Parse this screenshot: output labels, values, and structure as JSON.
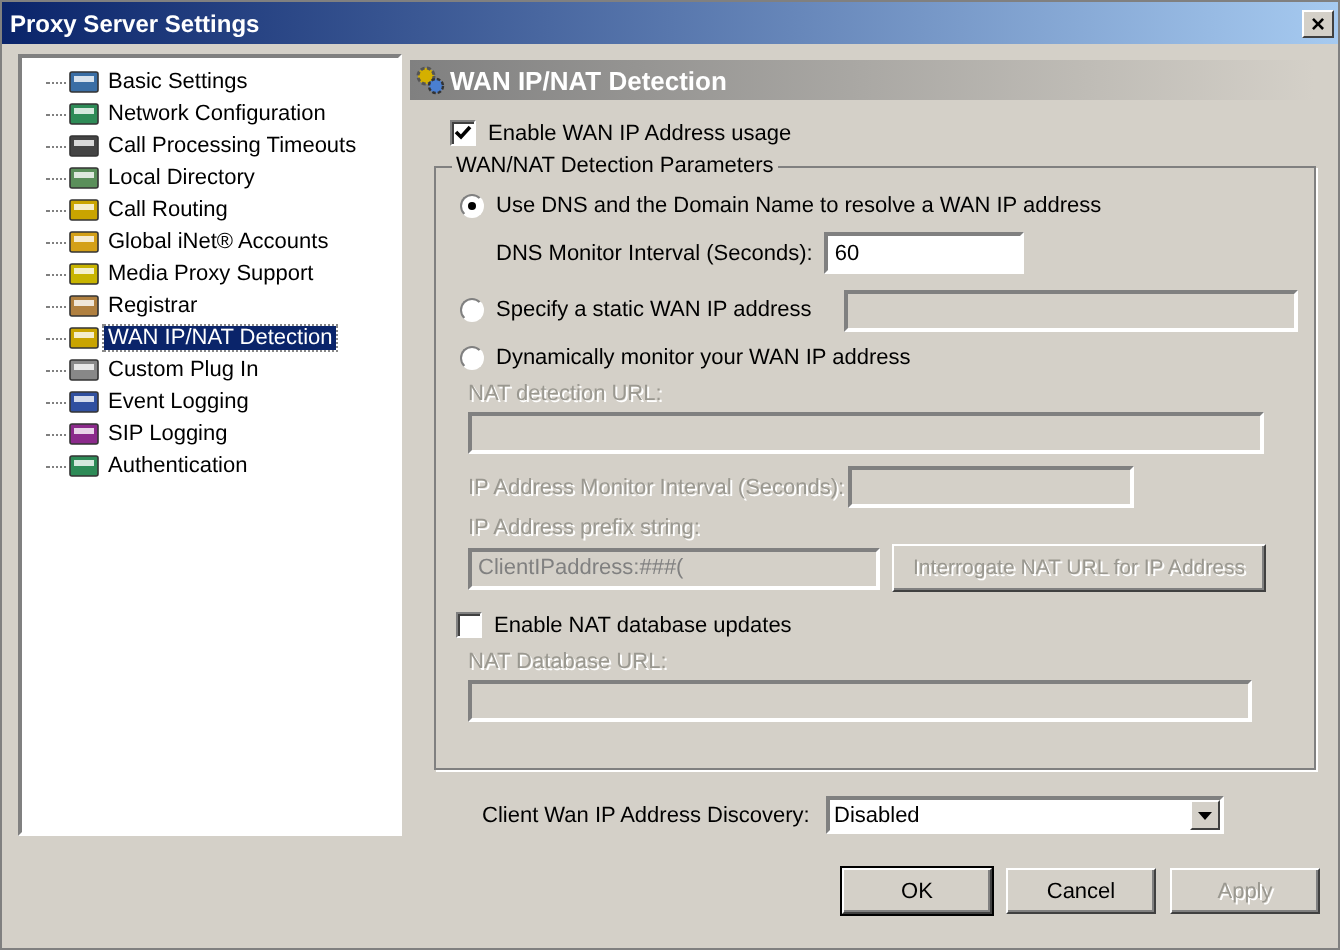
{
  "window": {
    "title": "Proxy Server Settings",
    "close": "×"
  },
  "sidebar": {
    "items": [
      {
        "label": "Basic Settings",
        "selected": false
      },
      {
        "label": "Network Configuration",
        "selected": false
      },
      {
        "label": "Call Processing Timeouts",
        "selected": false
      },
      {
        "label": "Local Directory",
        "selected": false
      },
      {
        "label": "Call Routing",
        "selected": false
      },
      {
        "label": "Global iNet® Accounts",
        "selected": false
      },
      {
        "label": "Media Proxy Support",
        "selected": false
      },
      {
        "label": "Registrar",
        "selected": false
      },
      {
        "label": "WAN IP/NAT Detection",
        "selected": true
      },
      {
        "label": "Custom Plug In",
        "selected": false
      },
      {
        "label": "Event Logging",
        "selected": false
      },
      {
        "label": "SIP Logging",
        "selected": false
      },
      {
        "label": "Authentication",
        "selected": false
      }
    ]
  },
  "panel": {
    "title": "WAN IP/NAT Detection",
    "enable_wan": {
      "label": "Enable WAN IP Address usage",
      "checked": true
    },
    "group": {
      "title": "WAN/NAT Detection Parameters",
      "radios": [
        {
          "label": "Use DNS and the Domain Name to resolve a WAN IP address",
          "selected": true
        },
        {
          "label": "Specify a static WAN IP address",
          "selected": false
        },
        {
          "label": "Dynamically monitor your WAN IP address",
          "selected": false
        }
      ],
      "dns_interval": {
        "label": "DNS Monitor Interval (Seconds):",
        "value": "60",
        "disabled": false
      },
      "static_ip": {
        "disabled": true
      },
      "nat_url": {
        "label": "NAT detection URL:",
        "disabled": true
      },
      "ip_interval": {
        "label": "IP Address Monitor Interval (Seconds):",
        "disabled": true
      },
      "prefix": {
        "label": "IP Address prefix string:",
        "value": "ClientIPaddress:###(",
        "disabled": true
      },
      "interrogate": {
        "label": "Interrogate NAT URL for IP Address",
        "disabled": true
      },
      "nat_db": {
        "label": "Enable NAT database updates",
        "checked": false
      },
      "nat_db_url": {
        "label": "NAT Database URL:",
        "disabled": true
      }
    },
    "discovery": {
      "label": "Client Wan IP Address Discovery:",
      "value": "Disabled"
    }
  },
  "buttons": [
    {
      "label": "OK",
      "disabled": false,
      "default": true
    },
    {
      "label": "Cancel",
      "disabled": false,
      "default": false
    },
    {
      "label": "Apply",
      "disabled": true,
      "default": false
    }
  ]
}
